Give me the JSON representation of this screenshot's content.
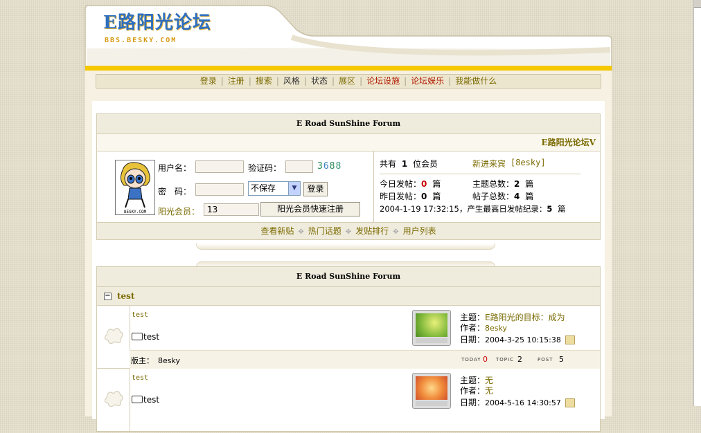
{
  "header": {
    "logo_cn": "E路阳光论坛",
    "logo_en": "BBS.BESKY.COM"
  },
  "nav": [
    {
      "label": "登录",
      "style": "gold"
    },
    {
      "label": "注册",
      "style": "gold"
    },
    {
      "label": "搜索",
      "style": "gold"
    },
    {
      "label": "风格",
      "style": "dark"
    },
    {
      "label": "状态",
      "style": "dark"
    },
    {
      "label": "展区",
      "style": "gold"
    },
    {
      "label": "论坛设施",
      "style": "red"
    },
    {
      "label": "论坛娱乐",
      "style": "red"
    },
    {
      "label": "我能做什么",
      "style": "gold"
    }
  ],
  "login_box": {
    "title": "E Road SunShine Forum",
    "brand": "E路阳光论坛V",
    "username_label": "用户名：",
    "captcha_label": "验证码：",
    "captcha_digits": [
      "3",
      "6",
      "8",
      "8"
    ],
    "captcha_colors": [
      "#2a8a5a",
      "#3a7fc0",
      "#2a8a5a",
      "#3a9a7a"
    ],
    "password_label": "密　码：",
    "remember_value": "不保存",
    "login_button": "登录",
    "member_label": "阳光会员：",
    "member_value": "13",
    "quick_register": "阳光会员快速注册",
    "stats": {
      "members_prefix": "共有",
      "members_count": "1",
      "members_suffix": "位会员",
      "newcomer_label": "新进来宾",
      "newcomer_name": "[8esky]",
      "today_label": "今日发帖：",
      "today_count": "0",
      "today_unit": "篇",
      "topics_label": "主题总数：",
      "topics_count": "2",
      "topics_unit": "篇",
      "yesterday_label": "昨日发帖：",
      "yesterday_count": "0",
      "yesterday_unit": "篇",
      "posts_label": "帖子总数：",
      "posts_count": "4",
      "posts_unit": "篇",
      "record_text": "2004-1-19 17:32:15，产生最高日发帖纪录：",
      "record_count": "5",
      "record_unit": "篇"
    },
    "links": [
      "查看新贴",
      "热门话题",
      "发贴排行",
      "用户列表"
    ]
  },
  "forum_box": {
    "title": "E Road SunShine Forum",
    "category": "test",
    "collapse_symbol": "−",
    "forums": [
      {
        "name": "test",
        "sub": "test",
        "topic_label": "主题：",
        "topic_value": "E路阳光的目标：成为",
        "author_label": "作者：",
        "author_value": "8esky",
        "date_label": "日期：",
        "date_value": "2004-3-25 10:15:38",
        "moderator_label": "版主：",
        "moderator_value": "8esky",
        "today_tag": "TODAY",
        "today_value": "0",
        "topic_tag": "TOPIC",
        "topic_count": "2",
        "post_tag": "POST",
        "post_count": "5"
      },
      {
        "name": "test",
        "sub": "test",
        "topic_label": "主题：",
        "topic_value": "无",
        "author_label": "作者：",
        "author_value": "无",
        "date_label": "日期：",
        "date_value": "2004-5-16 14:30:57"
      }
    ]
  },
  "colors": {
    "accent_gold": "#7a6a00",
    "accent_red": "#b01c00",
    "yellow_bar": "#f5c800",
    "logo_blue": "#2f6fbf"
  }
}
